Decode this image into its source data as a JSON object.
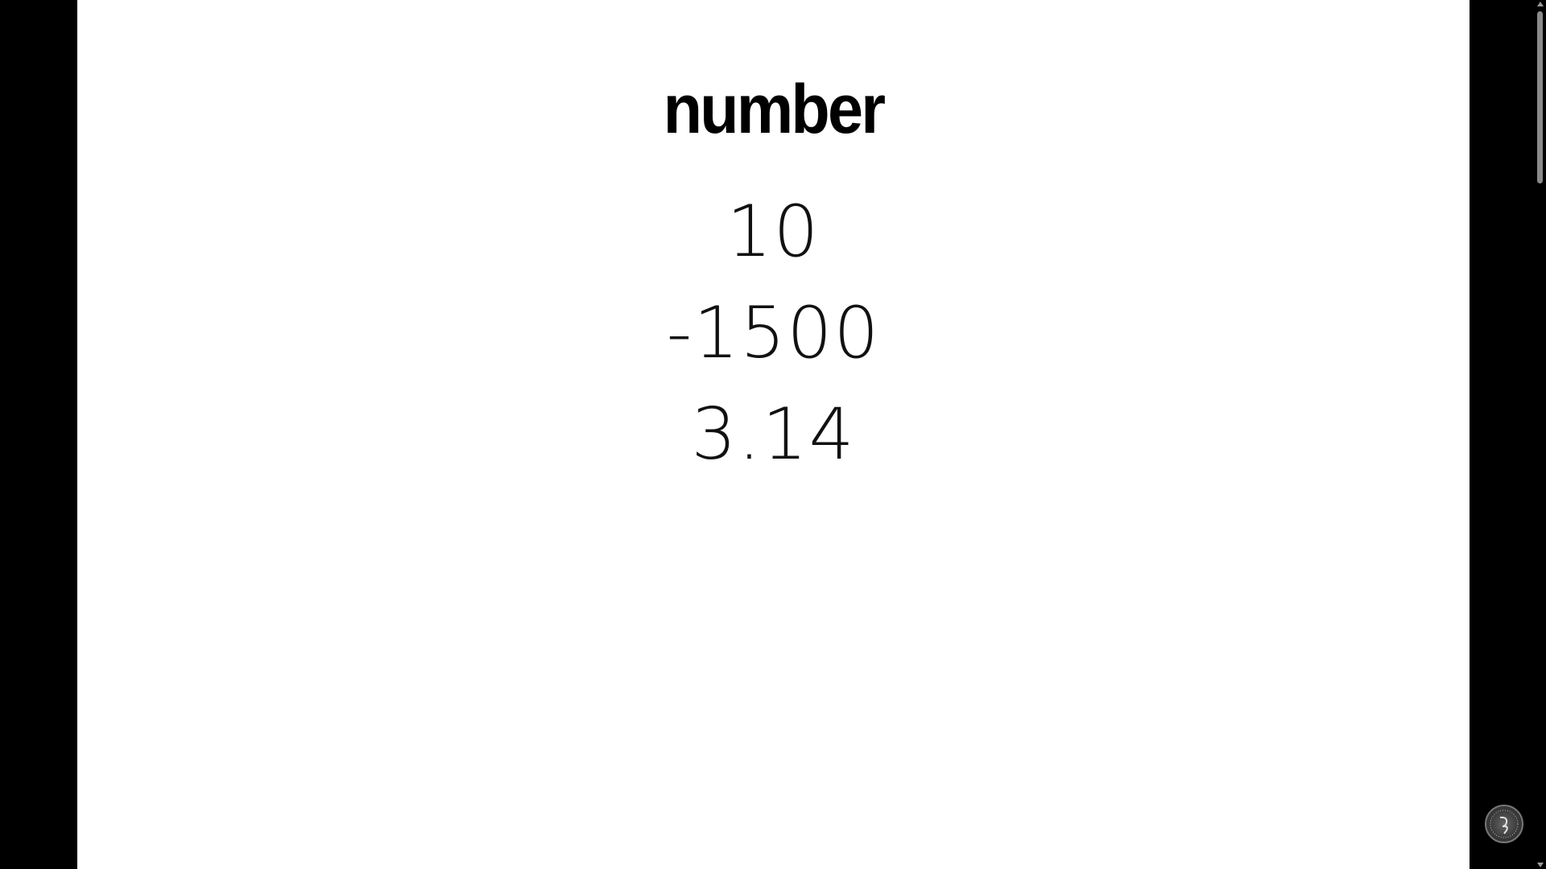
{
  "slide": {
    "title": "number",
    "values": [
      "10",
      "-1500",
      "3.14"
    ]
  },
  "icons": {
    "badge": "user-avatar-icon",
    "scroll_up": "arrow-up-icon",
    "scroll_down": "arrow-down-icon"
  },
  "colors": {
    "background": "#000000",
    "slide": "#ffffff",
    "text": "#000000"
  }
}
